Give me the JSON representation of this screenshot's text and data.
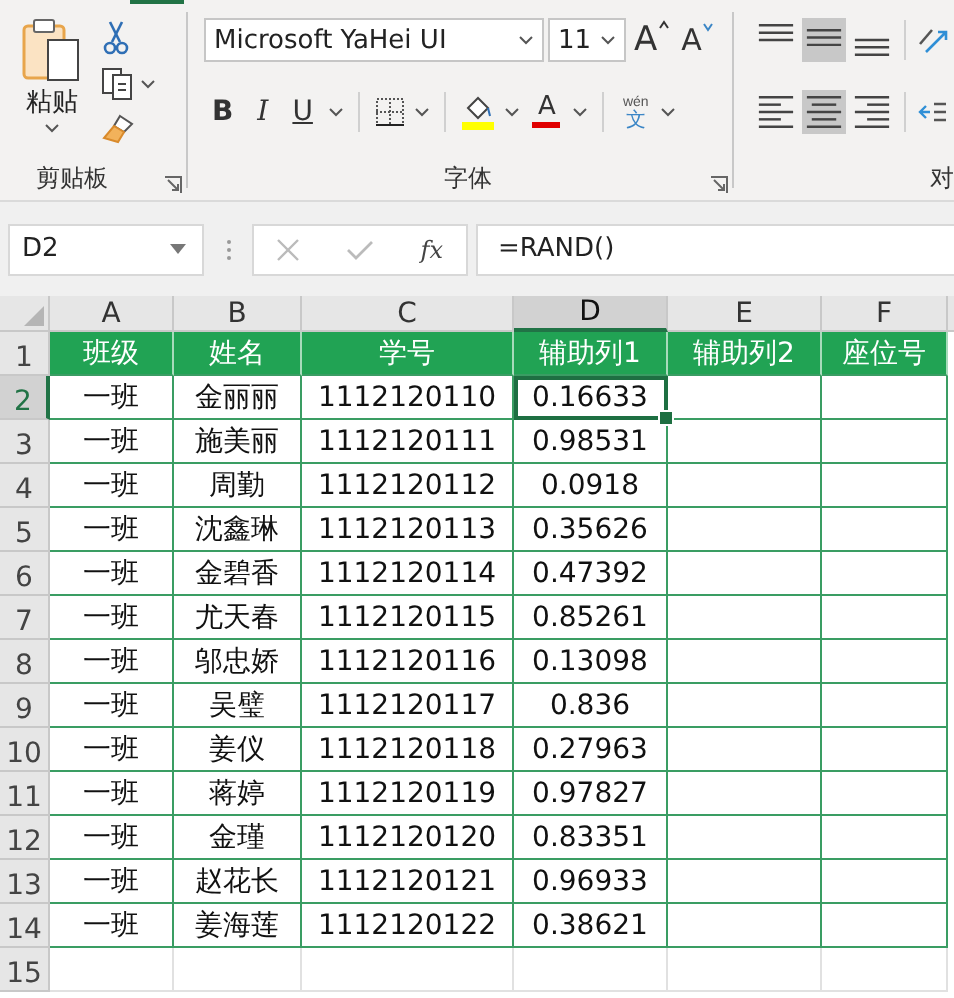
{
  "ribbon": {
    "clipboard": {
      "paste_label": "粘贴",
      "group_label": "剪贴板"
    },
    "font": {
      "font_name": "Microsoft YaHei UI",
      "font_size": "11",
      "grow_label": "A",
      "shrink_label": "A",
      "bold_label": "B",
      "italic_label": "I",
      "underline_label": "U",
      "font_color_label": "A",
      "phonetic_top": "wén",
      "phonetic_bottom": "文",
      "group_label": "字体"
    },
    "alignment": {
      "vertical": [
        {
          "kind": "top",
          "selected": false
        },
        {
          "kind": "middle",
          "selected": true
        },
        {
          "kind": "bottom",
          "selected": false
        }
      ],
      "horizontal": [
        {
          "kind": "left",
          "selected": false
        },
        {
          "kind": "center",
          "selected": true
        },
        {
          "kind": "right",
          "selected": false
        }
      ],
      "group_label": "对"
    }
  },
  "formula_bar": {
    "name_box": "D2",
    "fx": "fx",
    "formula": "=RAND()"
  },
  "sheet": {
    "columns": [
      {
        "label": "A",
        "selected": false
      },
      {
        "label": "B",
        "selected": false
      },
      {
        "label": "C",
        "selected": false
      },
      {
        "label": "D",
        "selected": true
      },
      {
        "label": "E",
        "selected": false
      },
      {
        "label": "F",
        "selected": false
      }
    ],
    "rows": [
      {
        "number": "1",
        "selected": false,
        "kind": "header",
        "cells": [
          "班级",
          "姓名",
          "学号",
          "辅助列1",
          "辅助列2",
          "座位号"
        ]
      },
      {
        "number": "2",
        "selected": true,
        "kind": "data",
        "cells": [
          "一班",
          "金丽丽",
          "1112120110",
          "0.16633"
        ]
      },
      {
        "number": "3",
        "selected": false,
        "kind": "data",
        "cells": [
          "一班",
          "施美丽",
          "1112120111",
          "0.98531"
        ]
      },
      {
        "number": "4",
        "selected": false,
        "kind": "data",
        "cells": [
          "一班",
          "周勤",
          "1112120112",
          "0.0918"
        ]
      },
      {
        "number": "5",
        "selected": false,
        "kind": "data",
        "cells": [
          "一班",
          "沈鑫琳",
          "1112120113",
          "0.35626"
        ]
      },
      {
        "number": "6",
        "selected": false,
        "kind": "data",
        "cells": [
          "一班",
          "金碧香",
          "1112120114",
          "0.47392"
        ]
      },
      {
        "number": "7",
        "selected": false,
        "kind": "data",
        "cells": [
          "一班",
          "尤天春",
          "1112120115",
          "0.85261"
        ]
      },
      {
        "number": "8",
        "selected": false,
        "kind": "data",
        "cells": [
          "一班",
          "邬忠娇",
          "1112120116",
          "0.13098"
        ]
      },
      {
        "number": "9",
        "selected": false,
        "kind": "data",
        "cells": [
          "一班",
          "吴璧",
          "1112120117",
          "0.836"
        ]
      },
      {
        "number": "10",
        "selected": false,
        "kind": "data",
        "cells": [
          "一班",
          "姜仪",
          "1112120118",
          "0.27963"
        ]
      },
      {
        "number": "11",
        "selected": false,
        "kind": "data",
        "cells": [
          "一班",
          "蒋婷",
          "1112120119",
          "0.97827"
        ]
      },
      {
        "number": "12",
        "selected": false,
        "kind": "data",
        "cells": [
          "一班",
          "金瑾",
          "1112120120",
          "0.83351"
        ]
      },
      {
        "number": "13",
        "selected": false,
        "kind": "data",
        "cells": [
          "一班",
          "赵花长",
          "1112120121",
          "0.96933"
        ]
      },
      {
        "number": "14",
        "selected": false,
        "kind": "data",
        "cells": [
          "一班",
          "姜海莲",
          "1112120122",
          "0.38621"
        ]
      },
      {
        "number": "15",
        "selected": false,
        "kind": "empty"
      }
    ]
  }
}
